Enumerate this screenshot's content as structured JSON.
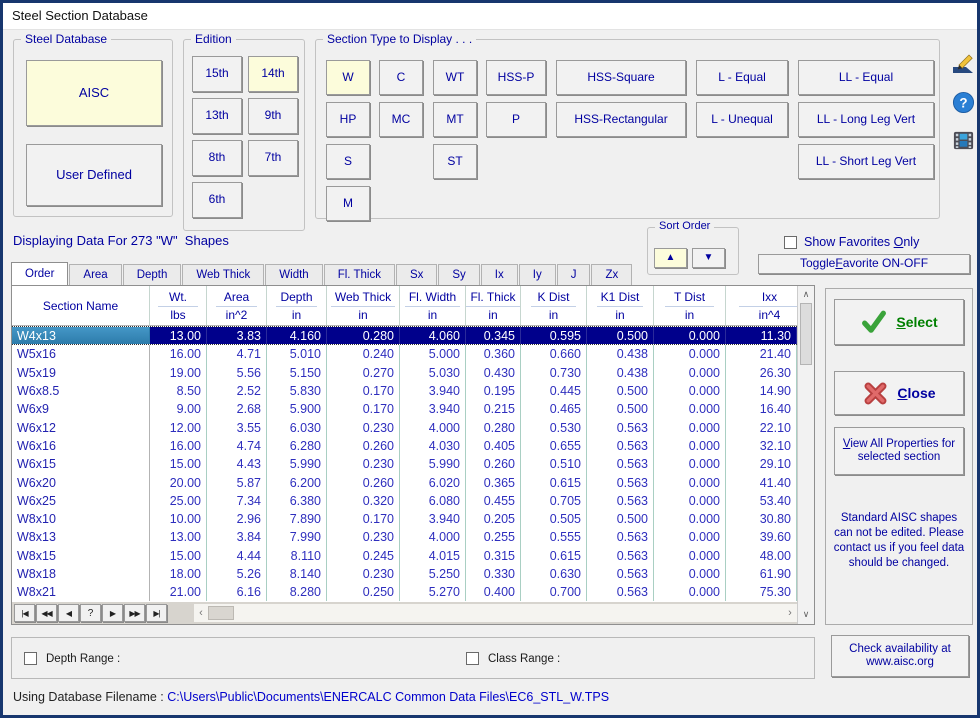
{
  "window": {
    "title": "Steel Section Database"
  },
  "steel_database": {
    "label": "Steel Database",
    "buttons": [
      {
        "label": "AISC",
        "selected": true
      },
      {
        "label": "User Defined",
        "selected": false
      }
    ]
  },
  "edition": {
    "label": "Edition",
    "buttons": [
      {
        "label": "15th",
        "row": 0,
        "col": 0,
        "selected": false
      },
      {
        "label": "14th",
        "row": 0,
        "col": 1,
        "selected": true
      },
      {
        "label": "13th",
        "row": 1,
        "col": 0,
        "selected": false
      },
      {
        "label": "9th",
        "row": 1,
        "col": 1,
        "selected": false
      },
      {
        "label": "8th",
        "row": 2,
        "col": 0,
        "selected": false
      },
      {
        "label": "7th",
        "row": 2,
        "col": 1,
        "selected": false
      },
      {
        "label": "6th",
        "row": 3,
        "col": 0,
        "selected": false
      }
    ]
  },
  "section_type": {
    "label": "Section Type to Display . . .",
    "buttons": [
      {
        "label": "W",
        "row": 0,
        "col": 0,
        "selected": true
      },
      {
        "label": "C",
        "row": 0,
        "col": 1,
        "selected": false
      },
      {
        "label": "WT",
        "row": 0,
        "col": 2,
        "selected": false
      },
      {
        "label": "HSS-P",
        "row": 0,
        "col": 3,
        "selected": false
      },
      {
        "label": "HSS-Square",
        "row": 0,
        "col": 4,
        "selected": false
      },
      {
        "label": "L - Equal",
        "row": 0,
        "col": 5,
        "selected": false
      },
      {
        "label": "LL - Equal",
        "row": 0,
        "col": 6,
        "selected": false
      },
      {
        "label": "HP",
        "row": 1,
        "col": 0,
        "selected": false
      },
      {
        "label": "MC",
        "row": 1,
        "col": 1,
        "selected": false
      },
      {
        "label": "MT",
        "row": 1,
        "col": 2,
        "selected": false
      },
      {
        "label": "P",
        "row": 1,
        "col": 3,
        "selected": false
      },
      {
        "label": "HSS-Rectangular",
        "row": 1,
        "col": 4,
        "selected": false
      },
      {
        "label": "L - Unequal",
        "row": 1,
        "col": 5,
        "selected": false
      },
      {
        "label": "LL - Long Leg Vert",
        "row": 1,
        "col": 6,
        "selected": false
      },
      {
        "label": "S",
        "row": 2,
        "col": 0,
        "selected": false
      },
      {
        "label": "ST",
        "row": 2,
        "col": 2,
        "selected": false
      },
      {
        "label": "LL - Short Leg Vert",
        "row": 2,
        "col": 6,
        "selected": false
      },
      {
        "label": "M",
        "row": 3,
        "col": 0,
        "selected": false
      }
    ]
  },
  "side_icons": [
    "edit-icon",
    "help-icon",
    "database-icon"
  ],
  "display_info": "Displaying Data For 273 \"W\"  Shapes",
  "sort_order": {
    "label": "Sort Order",
    "up_glyph": "▲",
    "down_glyph": "▼"
  },
  "favorites": {
    "show": {
      "label": "Show Favorites Only",
      "accel": "O"
    },
    "toggle": {
      "label": "Toggle Favorite ON-OFF",
      "accel": "F"
    }
  },
  "tabs": {
    "active": 0,
    "items": [
      "Order",
      "Area",
      "Depth",
      "Web Thick",
      "Width",
      "Fl. Thick",
      "Sx",
      "Sy",
      "Ix",
      "Iy",
      "J",
      "Zx"
    ]
  },
  "table": {
    "columns": [
      {
        "title": "Section Name",
        "unit": ""
      },
      {
        "title": "Wt.",
        "unit": "lbs"
      },
      {
        "title": "Area",
        "unit": "in^2"
      },
      {
        "title": "Depth",
        "unit": "in"
      },
      {
        "title": "Web Thick",
        "unit": "in"
      },
      {
        "title": "Fl. Width",
        "unit": "in"
      },
      {
        "title": "Fl. Thick",
        "unit": "in"
      },
      {
        "title": "K Dist",
        "unit": "in"
      },
      {
        "title": "K1 Dist",
        "unit": "in"
      },
      {
        "title": "T Dist",
        "unit": "in"
      },
      {
        "title": "Ixx",
        "unit": "in^4"
      }
    ],
    "selected_row": 0,
    "rows": [
      [
        "W4x13",
        "13.00",
        "3.83",
        "4.160",
        "0.280",
        "4.060",
        "0.345",
        "0.595",
        "0.500",
        "0.000",
        "11.30"
      ],
      [
        "W5x16",
        "16.00",
        "4.71",
        "5.010",
        "0.240",
        "5.000",
        "0.360",
        "0.660",
        "0.438",
        "0.000",
        "21.40"
      ],
      [
        "W5x19",
        "19.00",
        "5.56",
        "5.150",
        "0.270",
        "5.030",
        "0.430",
        "0.730",
        "0.438",
        "0.000",
        "26.30"
      ],
      [
        "W6x8.5",
        "8.50",
        "2.52",
        "5.830",
        "0.170",
        "3.940",
        "0.195",
        "0.445",
        "0.500",
        "0.000",
        "14.90"
      ],
      [
        "W6x9",
        "9.00",
        "2.68",
        "5.900",
        "0.170",
        "3.940",
        "0.215",
        "0.465",
        "0.500",
        "0.000",
        "16.40"
      ],
      [
        "W6x12",
        "12.00",
        "3.55",
        "6.030",
        "0.230",
        "4.000",
        "0.280",
        "0.530",
        "0.563",
        "0.000",
        "22.10"
      ],
      [
        "W6x16",
        "16.00",
        "4.74",
        "6.280",
        "0.260",
        "4.030",
        "0.405",
        "0.655",
        "0.563",
        "0.000",
        "32.10"
      ],
      [
        "W6x15",
        "15.00",
        "4.43",
        "5.990",
        "0.230",
        "5.990",
        "0.260",
        "0.510",
        "0.563",
        "0.000",
        "29.10"
      ],
      [
        "W6x20",
        "20.00",
        "5.87",
        "6.200",
        "0.260",
        "6.020",
        "0.365",
        "0.615",
        "0.563",
        "0.000",
        "41.40"
      ],
      [
        "W6x25",
        "25.00",
        "7.34",
        "6.380",
        "0.320",
        "6.080",
        "0.455",
        "0.705",
        "0.563",
        "0.000",
        "53.40"
      ],
      [
        "W8x10",
        "10.00",
        "2.96",
        "7.890",
        "0.170",
        "3.940",
        "0.205",
        "0.505",
        "0.500",
        "0.000",
        "30.80"
      ],
      [
        "W8x13",
        "13.00",
        "3.84",
        "7.990",
        "0.230",
        "4.000",
        "0.255",
        "0.555",
        "0.563",
        "0.000",
        "39.60"
      ],
      [
        "W8x15",
        "15.00",
        "4.44",
        "8.110",
        "0.245",
        "4.015",
        "0.315",
        "0.615",
        "0.563",
        "0.000",
        "48.00"
      ],
      [
        "W8x18",
        "18.00",
        "5.26",
        "8.140",
        "0.230",
        "5.250",
        "0.330",
        "0.630",
        "0.563",
        "0.000",
        "61.90"
      ],
      [
        "W8x21",
        "21.00",
        "6.16",
        "8.280",
        "0.250",
        "5.270",
        "0.400",
        "0.700",
        "0.563",
        "0.000",
        "75.30"
      ]
    ],
    "navigator": [
      "|◀",
      "◀◀",
      "◀",
      "?",
      "▶",
      "▶▶",
      "▶|"
    ]
  },
  "actions": {
    "select": {
      "label": "Select",
      "accel": "S"
    },
    "close": {
      "label": "Close",
      "accel": "C"
    },
    "view_all": {
      "label": "View All Properties for selected section",
      "accel": "V"
    },
    "notice": "Standard AISC shapes can not be edited. Please contact us if you feel data should be changed.",
    "check_availability": "Check availability at www.aisc.org"
  },
  "ranges": {
    "depth": {
      "label": "Depth Range :"
    },
    "class": {
      "label": "Class Range :"
    }
  },
  "status": {
    "prefix": "Using Database Filename : ",
    "path": "C:\\Users\\Public\\Documents\\ENERCALC Common Data Files\\EC6_STL_W.TPS"
  }
}
